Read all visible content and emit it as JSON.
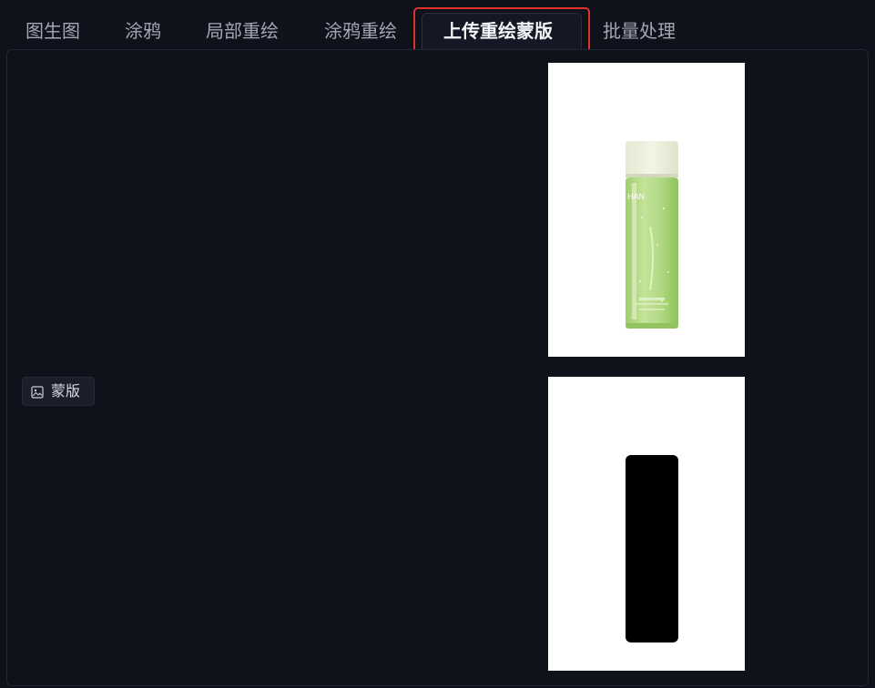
{
  "tabs": [
    {
      "label": "图生图",
      "active": false
    },
    {
      "label": "涂鸦",
      "active": false
    },
    {
      "label": "局部重绘",
      "active": false
    },
    {
      "label": "涂鸦重绘",
      "active": false
    },
    {
      "label": "上传重绘蒙版",
      "active": true
    },
    {
      "label": "批量处理",
      "active": false
    }
  ],
  "mask_section": {
    "label": "蒙版",
    "icon": "image-icon"
  },
  "images": {
    "product": {
      "icon": "green-toner-bottle",
      "brand_text": "HAN"
    },
    "mask": {
      "icon": "black-bottle-mask"
    }
  },
  "colors": {
    "background": "#0f111b",
    "active_tab_border": "#e0322a",
    "tab_text": "#a3a6b3",
    "active_tab_text": "#f4f5f8"
  }
}
